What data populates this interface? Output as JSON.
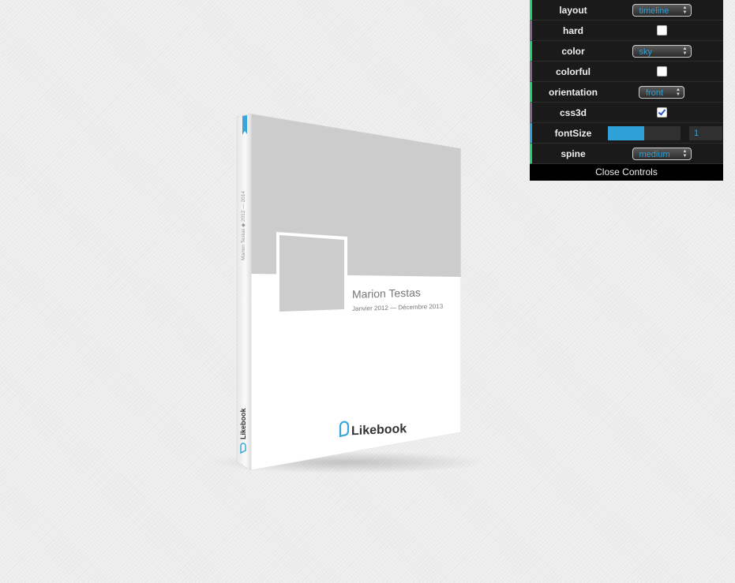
{
  "book": {
    "title": "Marion Testas",
    "dates": "Janvier 2012 — Décembre 2013",
    "brand": "Likebook",
    "spine_text": "Marion Testas  ◆  2012 — 2014",
    "colors": {
      "cover_gray": "#cccccc",
      "cover_white": "#ffffff",
      "accent": "#3aa6d8",
      "spine": "#f4f4f4"
    }
  },
  "controls": {
    "layout": {
      "label": "layout",
      "value": "timeline"
    },
    "hard": {
      "label": "hard",
      "checked": false
    },
    "color": {
      "label": "color",
      "value": "sky"
    },
    "colorful": {
      "label": "colorful",
      "checked": false
    },
    "orientation": {
      "label": "orientation",
      "value": "front"
    },
    "css3d": {
      "label": "css3d",
      "checked": true
    },
    "fontSize": {
      "label": "fontSize",
      "value": "1",
      "slider_fraction": 0.5
    },
    "spine": {
      "label": "spine",
      "value": "medium"
    },
    "close_label": "Close Controls",
    "colors": {
      "bg": "#1a1a1a",
      "string": "#1ed36f",
      "boolean": "#806787",
      "number": "#2fa1d6"
    }
  }
}
